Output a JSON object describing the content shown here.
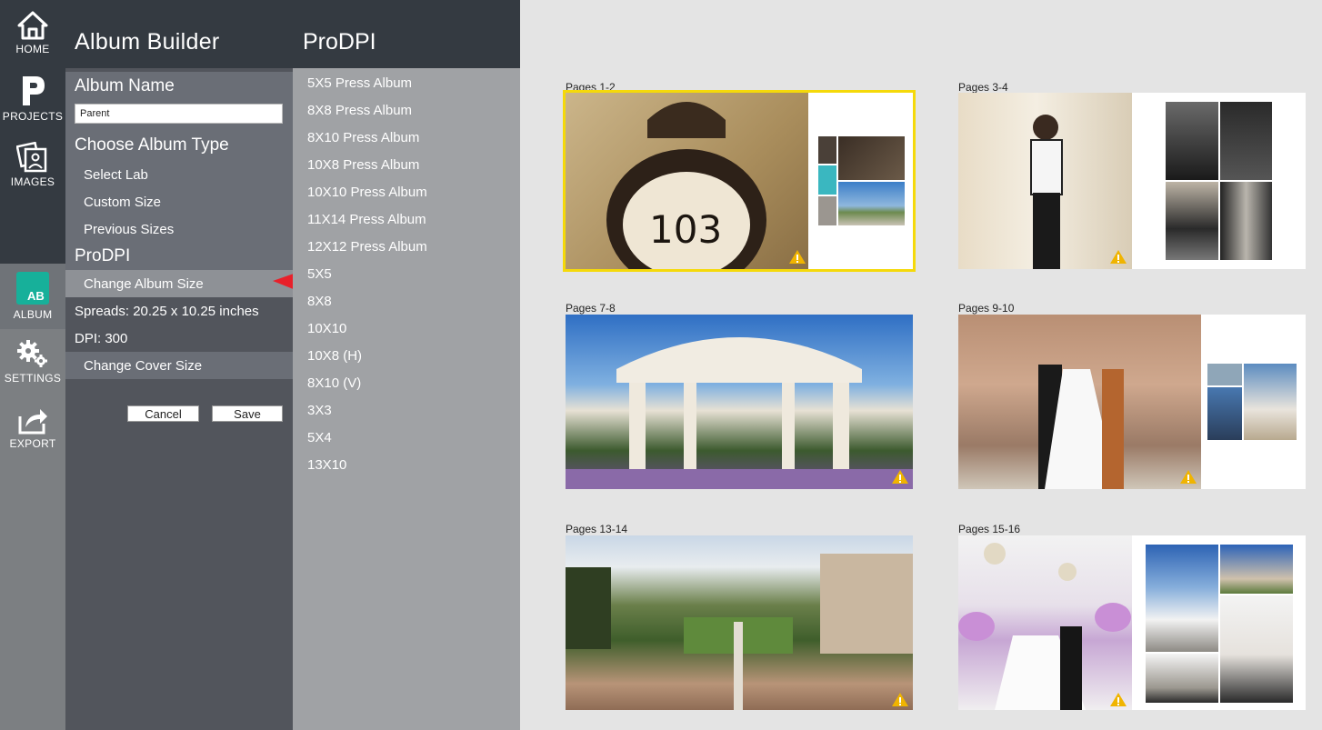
{
  "rail": {
    "home_label": "HOME",
    "projects_label": "PROJECTS",
    "images_label": "IMAGES",
    "album_label": "ALBUM",
    "settings_label": "SETTINGS",
    "export_label": "EXPORT",
    "album_icon_text": "AB"
  },
  "builder": {
    "title": "Album Builder",
    "album_name_heading": "Album Name",
    "album_name_value": "Parent",
    "album_type_heading": "Choose Album Type",
    "select_lab": "Select Lab",
    "custom_size": "Custom Size",
    "previous_sizes": "Previous Sizes",
    "lab_heading": "ProDPI",
    "change_album_size": "Change Album Size",
    "spreads_info": "Spreads: 20.25 x 10.25 inches",
    "dpi_info": "DPI: 300",
    "change_cover_size": "Change Cover Size",
    "cancel_label": "Cancel",
    "save_label": "Save"
  },
  "sizes": {
    "title": "ProDPI",
    "items": [
      "5X5 Press Album",
      "8X8 Press Album",
      "8X10 Press Album",
      "10X8 Press Album",
      "10X10 Press Album",
      "11X14 Press Album",
      "12X12 Press Album",
      "5X5",
      "8X8",
      "10X10",
      "10X8 (H)",
      "8X10 (V)",
      "3X3",
      "5X4",
      "13X10"
    ]
  },
  "spreads": [
    {
      "label": "Pages 1-2"
    },
    {
      "label": "Pages 3-4"
    },
    {
      "label": "Pages 7-8"
    },
    {
      "label": "Pages 9-10"
    },
    {
      "label": "Pages 13-14"
    },
    {
      "label": "Pages 15-16"
    }
  ],
  "colors": {
    "selection": "#f5d90a",
    "warning": "#f0b400",
    "album_icon": "#17b09a",
    "arrow": "#e8202a"
  }
}
